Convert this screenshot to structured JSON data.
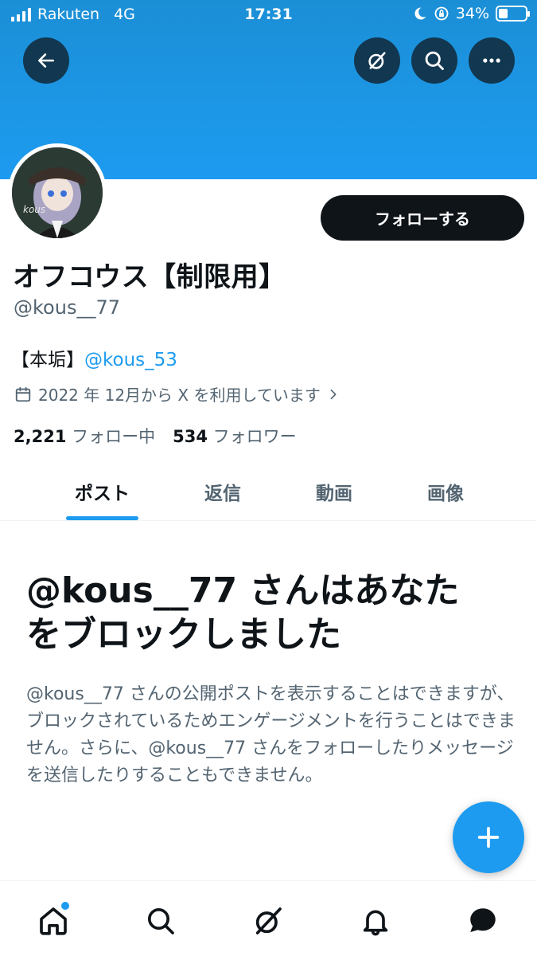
{
  "status_bar": {
    "carrier": "Rakuten",
    "network": "4G",
    "time": "17:31",
    "battery": "34%",
    "battery_level": 0.34
  },
  "header": {
    "back_icon": "arrow-left-icon",
    "grok_icon": "grok-icon",
    "search_icon": "search-icon",
    "more_icon": "more-icon"
  },
  "profile": {
    "avatar_text": "kous",
    "follow_label": "フォローする",
    "name": "オフコウス【制限用】",
    "handle": "@kous__77",
    "bio_prefix": "【本垢】",
    "bio_link": "@kous_53",
    "joined": "2022 年 12月から X を利用しています",
    "following_count": "2,221",
    "following_label": "フォロー中",
    "followers_count": "534",
    "followers_label": "フォロワー"
  },
  "tabs": [
    {
      "label": "ポスト",
      "active": true
    },
    {
      "label": "返信",
      "active": false
    },
    {
      "label": "動画",
      "active": false
    },
    {
      "label": "画像",
      "active": false
    }
  ],
  "blocked": {
    "title_line1": "@kous__77 さんはあなた",
    "title_line2": "をブロックしました",
    "description": "@kous__77 さんの公開ポストを表示することはできますが、ブロックされているためエンゲージメントを行うことはできません。さらに、@kous__77 さんをフォローしたりメッセージを送信したりすることもできません。"
  },
  "fab": {
    "icon": "plus-icon"
  },
  "bottom_nav": [
    {
      "icon": "home-icon"
    },
    {
      "icon": "search-icon"
    },
    {
      "icon": "grok-icon"
    },
    {
      "icon": "bell-icon"
    },
    {
      "icon": "messages-icon"
    }
  ],
  "colors": {
    "accent": "#1d9bf0",
    "text": "#0f1419",
    "muted": "#536471"
  }
}
